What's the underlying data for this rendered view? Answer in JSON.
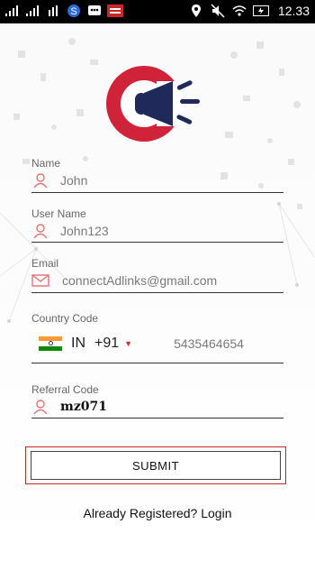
{
  "status_bar": {
    "time": "12.33",
    "left_icons": [
      "signal-icon",
      "signal-icon",
      "data-icon",
      "sync-icon",
      "bbm-icon",
      "app-icon"
    ],
    "right_icons": [
      "location-icon",
      "mute-icon",
      "wifi-icon",
      "battery-icon"
    ]
  },
  "form": {
    "name_label": "Name",
    "name_value": "John",
    "username_label": "User Name",
    "username_value": "John123",
    "email_label": "Email",
    "email_value": "connectAdlinks@gmail.com",
    "country_label": "Country Code",
    "country_code": "IN",
    "dial_code": "+91",
    "phone_value": "5435464654",
    "referral_label": "Referral Code",
    "referral_value": "mz071"
  },
  "actions": {
    "submit_label": "SUBMIT",
    "login_link": "Already Registered? Login"
  },
  "colors": {
    "brand_red": "#d0233a",
    "brand_navy": "#1f2a5a",
    "icon_red": "#e57373"
  }
}
